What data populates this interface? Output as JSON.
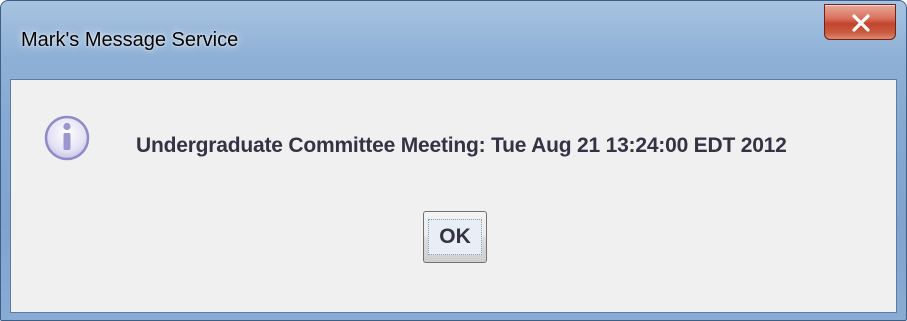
{
  "window": {
    "title": "Mark's Message Service"
  },
  "dialog": {
    "icon": "info-icon",
    "message": "Undergraduate Committee Meeting: Tue Aug 21 13:24:00 EDT 2012",
    "ok_label": "OK"
  },
  "colors": {
    "client_background": "#f0f0f0",
    "close_button": "#c2452d",
    "titlebar": "#8eb0d6",
    "message_text": "#333344"
  }
}
